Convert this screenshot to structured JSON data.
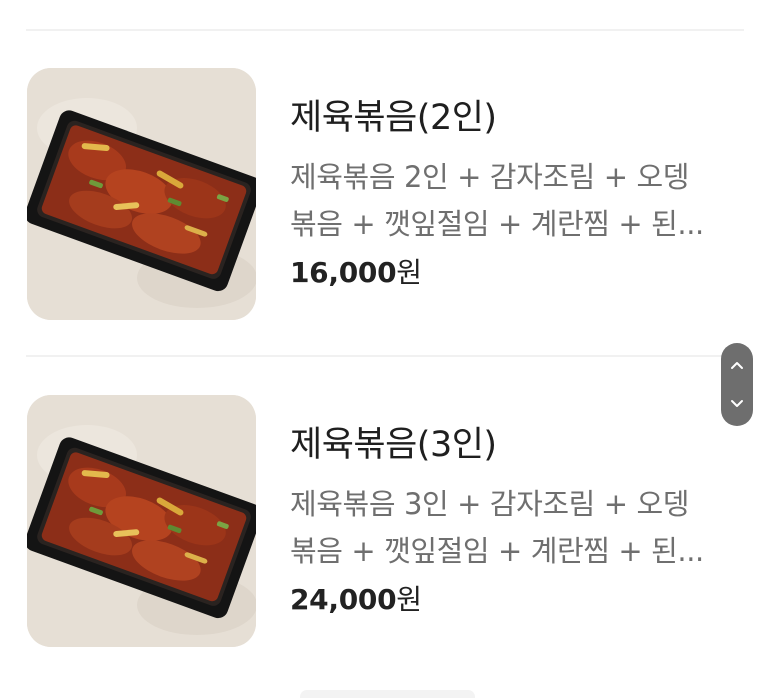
{
  "menu": {
    "items": [
      {
        "title": "제육볶음(2인)",
        "desc_line1": "제육볶음 2인 + 감자조림 + 오뎅",
        "desc_line2": "볶음 + 깻잎절임 + 계란찜 + 된...",
        "price_number": "16,000",
        "price_unit": "원"
      },
      {
        "title": "제육볶음(3인)",
        "desc_line1": "제육볶음 3인 + 감자조림 + 오뎅",
        "desc_line2": "볶음 + 깻잎절임 + 계란찜 + 된...",
        "price_number": "24,000",
        "price_unit": "원"
      }
    ]
  },
  "scroll_control": {
    "up_icon": "chevron-up-icon",
    "down_icon": "chevron-down-icon"
  },
  "colors": {
    "title": "#1f1f1f",
    "description": "#6f6f6f",
    "price": "#222222",
    "divider": "#f1f1f1",
    "scroll_pill": "#6e6e6e",
    "thumb_background": "#e7e0d6"
  }
}
